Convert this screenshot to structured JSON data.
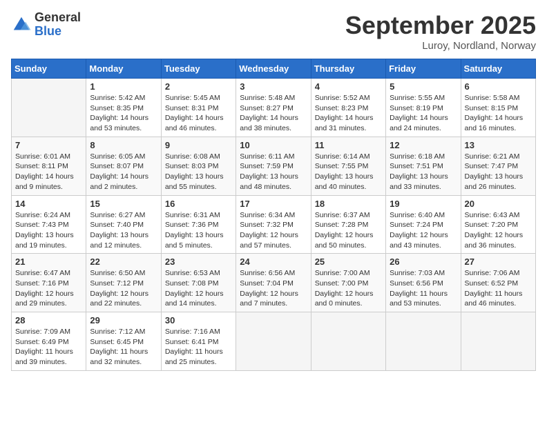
{
  "logo": {
    "general": "General",
    "blue": "Blue"
  },
  "title": "September 2025",
  "subtitle": "Luroy, Nordland, Norway",
  "days_of_week": [
    "Sunday",
    "Monday",
    "Tuesday",
    "Wednesday",
    "Thursday",
    "Friday",
    "Saturday"
  ],
  "weeks": [
    [
      {
        "day": "",
        "info": ""
      },
      {
        "day": "1",
        "info": "Sunrise: 5:42 AM\nSunset: 8:35 PM\nDaylight: 14 hours\nand 53 minutes."
      },
      {
        "day": "2",
        "info": "Sunrise: 5:45 AM\nSunset: 8:31 PM\nDaylight: 14 hours\nand 46 minutes."
      },
      {
        "day": "3",
        "info": "Sunrise: 5:48 AM\nSunset: 8:27 PM\nDaylight: 14 hours\nand 38 minutes."
      },
      {
        "day": "4",
        "info": "Sunrise: 5:52 AM\nSunset: 8:23 PM\nDaylight: 14 hours\nand 31 minutes."
      },
      {
        "day": "5",
        "info": "Sunrise: 5:55 AM\nSunset: 8:19 PM\nDaylight: 14 hours\nand 24 minutes."
      },
      {
        "day": "6",
        "info": "Sunrise: 5:58 AM\nSunset: 8:15 PM\nDaylight: 14 hours\nand 16 minutes."
      }
    ],
    [
      {
        "day": "7",
        "info": "Sunrise: 6:01 AM\nSunset: 8:11 PM\nDaylight: 14 hours\nand 9 minutes."
      },
      {
        "day": "8",
        "info": "Sunrise: 6:05 AM\nSunset: 8:07 PM\nDaylight: 14 hours\nand 2 minutes."
      },
      {
        "day": "9",
        "info": "Sunrise: 6:08 AM\nSunset: 8:03 PM\nDaylight: 13 hours\nand 55 minutes."
      },
      {
        "day": "10",
        "info": "Sunrise: 6:11 AM\nSunset: 7:59 PM\nDaylight: 13 hours\nand 48 minutes."
      },
      {
        "day": "11",
        "info": "Sunrise: 6:14 AM\nSunset: 7:55 PM\nDaylight: 13 hours\nand 40 minutes."
      },
      {
        "day": "12",
        "info": "Sunrise: 6:18 AM\nSunset: 7:51 PM\nDaylight: 13 hours\nand 33 minutes."
      },
      {
        "day": "13",
        "info": "Sunrise: 6:21 AM\nSunset: 7:47 PM\nDaylight: 13 hours\nand 26 minutes."
      }
    ],
    [
      {
        "day": "14",
        "info": "Sunrise: 6:24 AM\nSunset: 7:43 PM\nDaylight: 13 hours\nand 19 minutes."
      },
      {
        "day": "15",
        "info": "Sunrise: 6:27 AM\nSunset: 7:40 PM\nDaylight: 13 hours\nand 12 minutes."
      },
      {
        "day": "16",
        "info": "Sunrise: 6:31 AM\nSunset: 7:36 PM\nDaylight: 13 hours\nand 5 minutes."
      },
      {
        "day": "17",
        "info": "Sunrise: 6:34 AM\nSunset: 7:32 PM\nDaylight: 12 hours\nand 57 minutes."
      },
      {
        "day": "18",
        "info": "Sunrise: 6:37 AM\nSunset: 7:28 PM\nDaylight: 12 hours\nand 50 minutes."
      },
      {
        "day": "19",
        "info": "Sunrise: 6:40 AM\nSunset: 7:24 PM\nDaylight: 12 hours\nand 43 minutes."
      },
      {
        "day": "20",
        "info": "Sunrise: 6:43 AM\nSunset: 7:20 PM\nDaylight: 12 hours\nand 36 minutes."
      }
    ],
    [
      {
        "day": "21",
        "info": "Sunrise: 6:47 AM\nSunset: 7:16 PM\nDaylight: 12 hours\nand 29 minutes."
      },
      {
        "day": "22",
        "info": "Sunrise: 6:50 AM\nSunset: 7:12 PM\nDaylight: 12 hours\nand 22 minutes."
      },
      {
        "day": "23",
        "info": "Sunrise: 6:53 AM\nSunset: 7:08 PM\nDaylight: 12 hours\nand 14 minutes."
      },
      {
        "day": "24",
        "info": "Sunrise: 6:56 AM\nSunset: 7:04 PM\nDaylight: 12 hours\nand 7 minutes."
      },
      {
        "day": "25",
        "info": "Sunrise: 7:00 AM\nSunset: 7:00 PM\nDaylight: 12 hours\nand 0 minutes."
      },
      {
        "day": "26",
        "info": "Sunrise: 7:03 AM\nSunset: 6:56 PM\nDaylight: 11 hours\nand 53 minutes."
      },
      {
        "day": "27",
        "info": "Sunrise: 7:06 AM\nSunset: 6:52 PM\nDaylight: 11 hours\nand 46 minutes."
      }
    ],
    [
      {
        "day": "28",
        "info": "Sunrise: 7:09 AM\nSunset: 6:49 PM\nDaylight: 11 hours\nand 39 minutes."
      },
      {
        "day": "29",
        "info": "Sunrise: 7:12 AM\nSunset: 6:45 PM\nDaylight: 11 hours\nand 32 minutes."
      },
      {
        "day": "30",
        "info": "Sunrise: 7:16 AM\nSunset: 6:41 PM\nDaylight: 11 hours\nand 25 minutes."
      },
      {
        "day": "",
        "info": ""
      },
      {
        "day": "",
        "info": ""
      },
      {
        "day": "",
        "info": ""
      },
      {
        "day": "",
        "info": ""
      }
    ]
  ]
}
